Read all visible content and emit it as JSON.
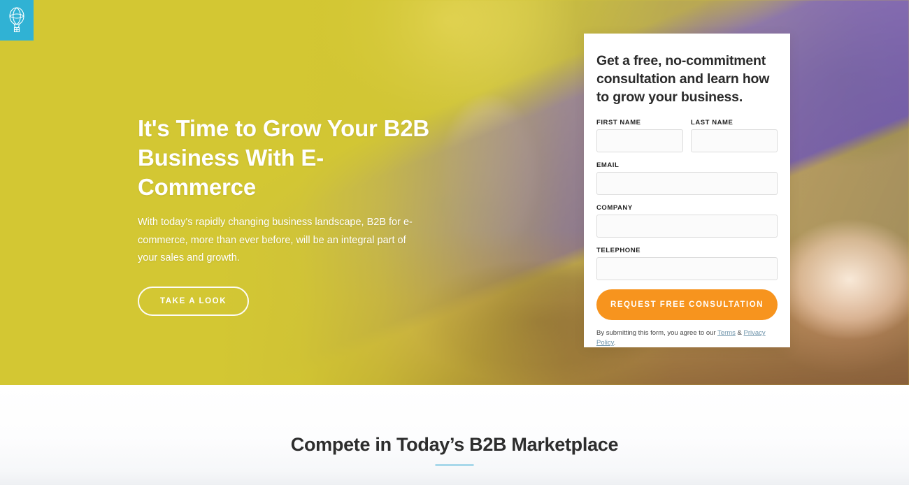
{
  "brand": {
    "logo_icon": "hot-air-balloon-icon",
    "logo_bg_color": "#30b2d4"
  },
  "hero": {
    "background_color": "#d3c733",
    "title": "It's Time to Grow Your B2B Business With E-Commerce",
    "subtitle": "With today's rapidly changing business landscape, B2B for e-commerce, more than ever before, will be an integral part of your sales and growth.",
    "cta_label": "TAKE A LOOK"
  },
  "form": {
    "heading": "Get a free, no-commitment consultation and learn how to grow your business.",
    "fields": [
      {
        "label": "FIRST NAME",
        "value": "",
        "placeholder": "",
        "name": "first-name"
      },
      {
        "label": "LAST NAME",
        "value": "",
        "placeholder": "",
        "name": "last-name"
      },
      {
        "label": "EMAIL",
        "value": "",
        "placeholder": "",
        "name": "email"
      },
      {
        "label": "COMPANY",
        "value": "",
        "placeholder": "",
        "name": "company"
      },
      {
        "label": "TELEPHONE",
        "value": "",
        "placeholder": "",
        "name": "telephone"
      }
    ],
    "submit_label": "REQUEST FREE CONSULTATION",
    "submit_color": "#f7941e",
    "fine_print_prefix": "By submitting this form, you agree to our ",
    "terms_link": "Terms",
    "fine_print_separator": " & ",
    "privacy_link": "Privacy Policy",
    "fine_print_suffix": "."
  },
  "section": {
    "title": "Compete in Today’s B2B Marketplace",
    "rule_color": "#a8d8ea"
  }
}
